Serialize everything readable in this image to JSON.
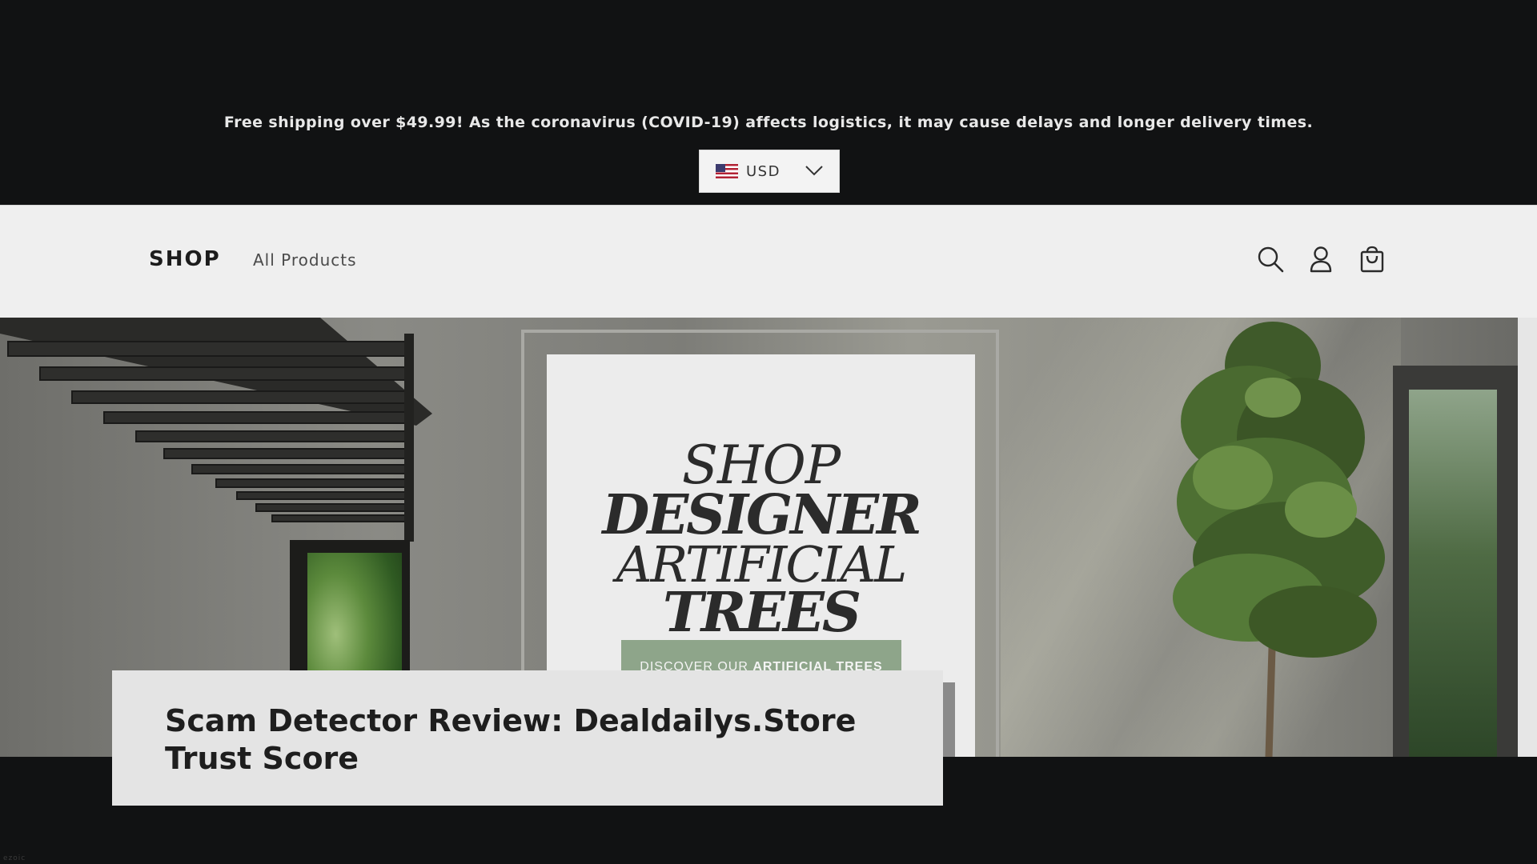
{
  "announcement": {
    "text": "Free shipping over $49.99! As the coronavirus (COVID-19) affects logistics, it may cause delays and longer delivery times."
  },
  "currency_selector": {
    "flag": "us-flag-icon",
    "selected": "USD",
    "icon": "chevron-down-icon"
  },
  "header": {
    "logo": "SHOP",
    "nav": [
      {
        "label": "All Products"
      }
    ],
    "icons": [
      "search-icon",
      "account-icon",
      "cart-icon"
    ]
  },
  "hero": {
    "poster": {
      "line1": "SHOP",
      "line2": "DESIGNER",
      "line3": "ARTIFICIAL",
      "line4": "TREES",
      "button_prefix": "DISCOVER OUR ",
      "button_emphasis": "ARTIFICIAL TREES"
    }
  },
  "card": {
    "line1": "Scam Detector Review: Dealdailys.Store",
    "line2": "Trust Score"
  },
  "watermark": "ezoic",
  "colors": {
    "page_background": "#111213",
    "header_background": "#efefef",
    "poster_background": "#ececec",
    "button_green": "#8ea58a",
    "card_background": "#e4e4e4"
  }
}
